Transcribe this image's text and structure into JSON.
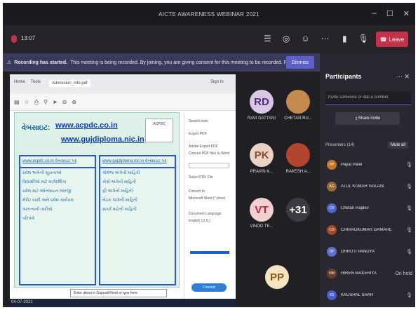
{
  "window": {
    "title": "AICTE AWARENESS WEBINAR 2021"
  },
  "toolbar": {
    "timer": "13:07",
    "leave_label": "Leave"
  },
  "banner": {
    "heading": "Recording has started.",
    "message": "This meeting is being recorded. By joining, you are giving consent for this meeting to be recorded. Priv...",
    "dismiss_label": "Dismiss"
  },
  "shared_screen": {
    "tab_labels": [
      "Home",
      "Tools",
      "Admission_info.pdf"
    ],
    "sign_in": "Sign In",
    "doc_heading": "વેબસાઇટ:",
    "links": [
      "www.acpdc.co.in",
      "www.gujdiploma.nic.in"
    ],
    "logo_text": "ACPDC",
    "left_col": {
      "head": "www.acpdc.co.in વેબસાઇટ પર",
      "items": [
        "પ્રવેશ અંગેની સૂચનાઓ",
        "વિદ્યાર્થીઓ માટે માર્ગદર્શિકા",
        "પ્રવેશ માટે ઓનલાઇન અરજી",
        "મેરીટ યાદી અને પ્રવેશ કાર્યક્રમ",
        "અગત્યની તારીખો",
        "પરિપત્રો"
      ]
    },
    "right_col": {
      "head": "www.gujdiploma.nic.in વેબસાઇટ પર",
      "items": [
        "કોલેજ અંગેની માહિતી",
        "કોર્સ અંગેની માહિતી",
        "ફી અંગેની માહિતી",
        "બેઠક અંગેની માહિતી",
        "સંપર્ક માટેની માહિતી"
      ]
    },
    "side_panel": {
      "items": [
        "Search tools",
        "Export PDF",
        "Adobe Export PDF",
        "Convert PDF files to Word",
        "Select PDF File",
        "Convert to",
        "Microsoft Word (*.docx)",
        "Document Language",
        "English (U.S.)"
      ],
      "button": "Convert"
    },
    "download_bar": "Enter about in Gujarati/Hindi or type here",
    "taskbar_clock": "04-07-2021"
  },
  "tiles": [
    {
      "initials": "RD",
      "label": "RAVI DATTANI",
      "bg": "#d8c8e6",
      "fg": "#4b2e78"
    },
    {
      "initials": "",
      "label": "CHETAN RU...",
      "bg": "#c58a4e",
      "fg": "#ffffff"
    },
    {
      "initials": "PK",
      "label": "PRAVIN K...",
      "bg": "#e8d3c4",
      "fg": "#8a4b2a"
    },
    {
      "initials": "",
      "label": "RAKESH A...",
      "bg": "#b3452e",
      "fg": "#ffffff"
    },
    {
      "initials": "VT",
      "label": "VINOD TE...",
      "bg": "#f2d0d0",
      "fg": "#b0263a"
    },
    {
      "initials": "+31",
      "label": "",
      "bg": "#3c3b44",
      "fg": "#ffffff"
    },
    {
      "initials": "PP",
      "label": "",
      "bg": "#f4e4c2",
      "fg": "#8a5b14"
    }
  ],
  "participants_panel": {
    "title": "Participants",
    "invite_placeholder": "Invite someone or dial a number",
    "share_invite": "Share invite",
    "presenters_label": "Presenters (14)",
    "mute_all": "Mute all",
    "people": [
      {
        "name": "Payal Patel",
        "initials": "PP",
        "color": "#c8762a",
        "status": ""
      },
      {
        "name": "ATUL KUMAR GALANI",
        "initials": "AG",
        "color": "#9a6b3a",
        "status": ""
      },
      {
        "name": "Chetan Rajdev",
        "initials": "CR",
        "color": "#5066c8",
        "status": ""
      },
      {
        "name": "CHIRAGKUMAR GAMARE",
        "initials": "CG",
        "color": "#a04a2a",
        "status": ""
      },
      {
        "name": "DHRUTI PANDYA",
        "initials": "DP",
        "color": "#5a6fd0",
        "status": ""
      },
      {
        "name": "HIREN MAKERIYA",
        "initials": "HM",
        "color": "#6a3f2a",
        "status": "On hold"
      },
      {
        "name": "KAUSHAL SHAH",
        "initials": "KS",
        "color": "#4b5bd0",
        "status": ""
      }
    ]
  },
  "colors": {
    "leave": "#c4314b",
    "accent": "#5b5fc7",
    "panel_bg": "#292830"
  }
}
